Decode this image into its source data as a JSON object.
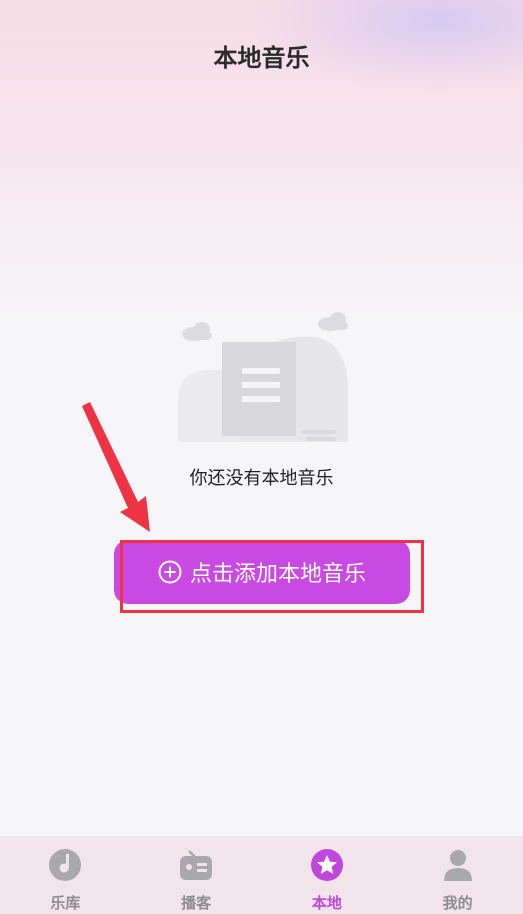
{
  "header": {
    "title": "本地音乐"
  },
  "empty_state": {
    "message": "你还没有本地音乐",
    "illustration": "empty-document-icon"
  },
  "add_button": {
    "label": "点击添加本地音乐",
    "icon": "plus-circle-icon"
  },
  "tabbar": {
    "items": [
      {
        "label": "乐库",
        "icon": "music-disc-icon",
        "active": false
      },
      {
        "label": "播客",
        "icon": "radio-icon",
        "active": false
      },
      {
        "label": "本地",
        "icon": "star-icon",
        "active": true
      },
      {
        "label": "我的",
        "icon": "user-icon",
        "active": false
      }
    ]
  },
  "colors": {
    "accent": "#c94ae2",
    "active_tab": "#c046dc",
    "inactive_tab": "#8d8d8d",
    "annotation_red": "#ee3344"
  }
}
